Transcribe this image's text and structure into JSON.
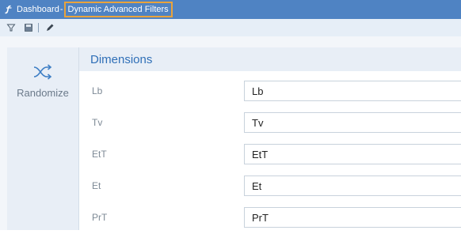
{
  "window": {
    "title": "Dashboard",
    "separator": "-",
    "subtitle": "Dynamic Advanced Filters"
  },
  "icons": {
    "app": "app-logo-icon",
    "toolbar": [
      "filter-icon",
      "save-icon",
      "edit-pencil-icon"
    ],
    "randomize": "shuffle-icon"
  },
  "sidebar": {
    "randomize_label": "Randomize"
  },
  "panel": {
    "title": "Dimensions",
    "rows": [
      {
        "label": "Lb",
        "value": "Lb"
      },
      {
        "label": "Tv",
        "value": "Tv"
      },
      {
        "label": "EtT",
        "value": "EtT"
      },
      {
        "label": "Et",
        "value": "Et"
      },
      {
        "label": "PrT",
        "value": "PrT"
      }
    ]
  },
  "colors": {
    "titlebar": "#4f83c3",
    "highlight_border": "#e9a33c",
    "accent_text": "#2f6fb7",
    "sidebar_bg": "#e8eef6"
  }
}
